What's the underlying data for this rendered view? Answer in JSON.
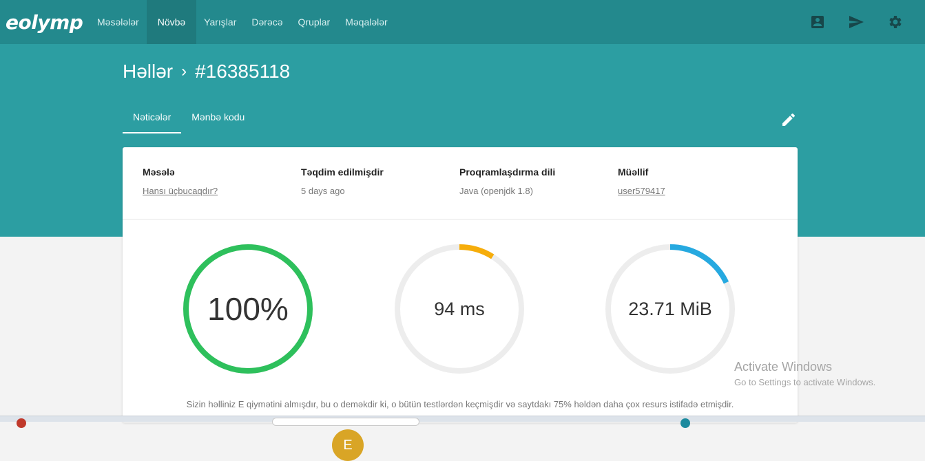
{
  "nav": {
    "logo": "eolymp",
    "items": [
      {
        "label": "Məsələlər",
        "active": false
      },
      {
        "label": "Növbə",
        "active": true
      },
      {
        "label": "Yarışlar",
        "active": false
      },
      {
        "label": "Dərəcə",
        "active": false
      },
      {
        "label": "Qruplar",
        "active": false
      },
      {
        "label": "Məqalələr",
        "active": false
      }
    ],
    "icons": [
      "account-box-icon",
      "send-icon",
      "settings-icon"
    ]
  },
  "breadcrumb": {
    "parent": "Həllər",
    "separator": "›",
    "current": "#16385118"
  },
  "tabs": [
    {
      "label": "Nəticələr",
      "active": true
    },
    {
      "label": "Mənbə kodu",
      "active": false
    }
  ],
  "meta": {
    "problem": {
      "label": "Məsələ",
      "value": "Hansı üçbucaqdır?"
    },
    "submitted": {
      "label": "Təqdim edilmişdir",
      "value": "5 days ago"
    },
    "language": {
      "label": "Proqramlaşdırma dili",
      "value": "Java (openjdk 1.8)"
    },
    "author": {
      "label": "Müəllif",
      "value": "user579417"
    }
  },
  "results": {
    "score": {
      "text": "100%",
      "fraction": 1.0,
      "color": "#2ec05c"
    },
    "grade": {
      "text": "E",
      "color": "#d9a526"
    },
    "time": {
      "text": "94 ms",
      "fraction": 0.09,
      "color": "#f6ad0b"
    },
    "memory": {
      "text": "23.71 MiB",
      "fraction": 0.18,
      "color": "#26a9e0"
    },
    "track_color": "#ededed",
    "summary": "Sizin həlliniz E qiymətini almışdır, bu o deməkdir ki, o bütün testlərdən keçmişdir və saytdakı 75% həldən daha çox resurs istifadə etmişdir."
  },
  "watermark": {
    "title": "Activate Windows",
    "subtitle": "Go to Settings to activate Windows."
  }
}
